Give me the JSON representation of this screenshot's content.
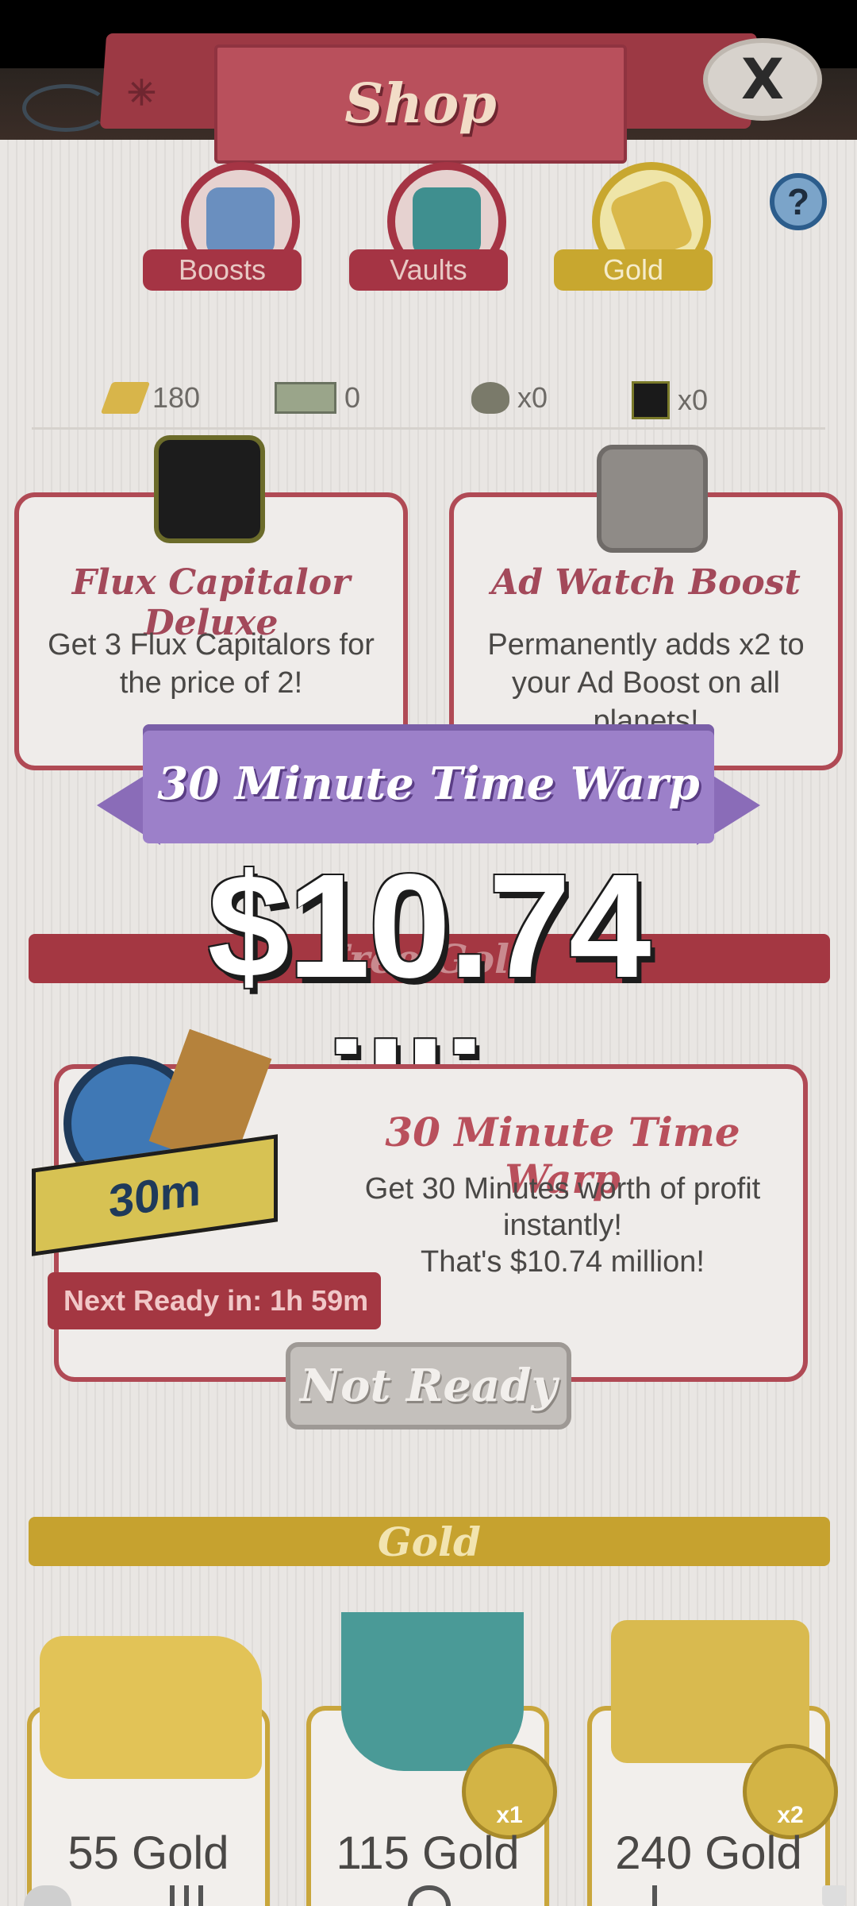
{
  "shop": {
    "title": "Shop",
    "close_label": "X",
    "help_label": "?",
    "tabs": [
      {
        "label": "Boosts",
        "icon": "money-bag-icon"
      },
      {
        "label": "Vaults",
        "icon": "vault-icon"
      },
      {
        "label": "Gold",
        "icon": "gold-bars-icon"
      }
    ],
    "currencies": [
      {
        "icon": "gold-bar-icon",
        "value": "180"
      },
      {
        "icon": "megabucks-icon",
        "value": "0"
      },
      {
        "icon": "money-bag-icon",
        "value": "x0"
      },
      {
        "icon": "flux-capitalor-icon",
        "value": "x0"
      }
    ]
  },
  "offers": [
    {
      "title": "Flux Capitalor Deluxe",
      "desc": "Get 3 Flux Capitalors for the price of 2!",
      "icon": "flux-capitalor-icon"
    },
    {
      "title": "Ad Watch Boost",
      "desc": "Permanently adds x2 to your Ad Boost on all planets!",
      "icon": "tv-icon"
    }
  ],
  "popup": {
    "banner": "30 Minute Time Warp",
    "amount": "$10.74 million"
  },
  "free_section": {
    "header": "Free Gold"
  },
  "time_warp": {
    "title": "30 Minute Time Warp",
    "desc_line1": "Get 30 Minutes worth of profit instantly!",
    "desc_line2": "That's $10.74 million!",
    "badge": "30m",
    "next_ready": "Next Ready in: 1h 59m",
    "button": "Not Ready"
  },
  "gold_section": {
    "header": "Gold",
    "packages": [
      {
        "label": "55 Gold",
        "multiplier": ""
      },
      {
        "label": "115 Gold",
        "multiplier": "x1"
      },
      {
        "label": "240 Gold",
        "multiplier": "x2"
      }
    ]
  },
  "colors": {
    "accent_red": "#b04a55",
    "gold": "#c9a63c",
    "purple": "#9c80c9"
  }
}
